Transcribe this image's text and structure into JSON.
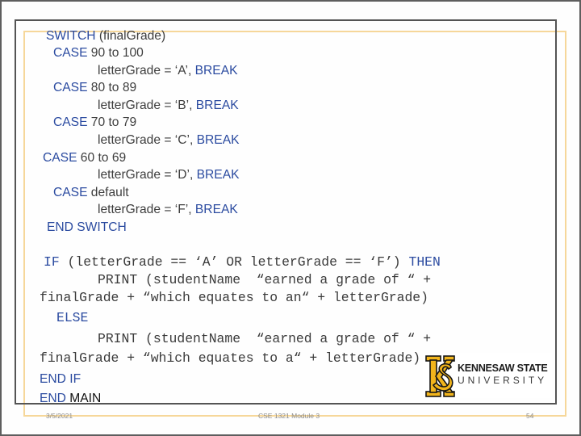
{
  "theme": {
    "keyword_color": "#2B4BA0",
    "logo_gold": "#F2B51C",
    "frame_gold": "#F6D79A"
  },
  "code": {
    "switch_block": [
      [
        "SWITCH",
        " (finalGrade)"
      ],
      [
        "CASE",
        " 90 to 100"
      ],
      [
        "letterGrade = ‘A’, ",
        "BREAK"
      ],
      [
        "CASE",
        " 80 to 89"
      ],
      [
        "letterGrade = ‘B’, ",
        "BREAK"
      ],
      [
        "CASE",
        " 70 to 79"
      ],
      [
        "letterGrade = ‘C’, ",
        "BREAK"
      ],
      [
        "CASE",
        " 60 to 69"
      ],
      [
        "letterGrade = ‘D’, ",
        "BREAK"
      ],
      [
        "CASE",
        " default"
      ],
      [
        "letterGrade = ‘F’, ",
        "BREAK"
      ],
      [
        "END SWITCH"
      ]
    ],
    "if_block": [
      [
        "IF",
        " (letterGrade == ‘A’ OR letterGrade == ‘F’) ",
        "THEN"
      ],
      [
        "PRINT (studentName  “earned a grade of “ +"
      ],
      [
        "finalGrade + “which equates to an“ + letterGrade)"
      ],
      [
        "ELSE"
      ],
      [
        "PRINT (studentName  “earned a grade of “ +"
      ],
      [
        "finalGrade + “which equates to a“ + letterGrade)"
      ]
    ],
    "end_block": [
      [
        "END IF"
      ],
      [
        "END",
        " MAIN"
      ]
    ]
  },
  "footer": {
    "date": "3/5/2021",
    "course": "CSE 1321 Module 3",
    "page_number": "54"
  },
  "logo": {
    "monogram": "KS",
    "line1": "KENNESAW STATE",
    "line2": "UNIVERSITY"
  }
}
